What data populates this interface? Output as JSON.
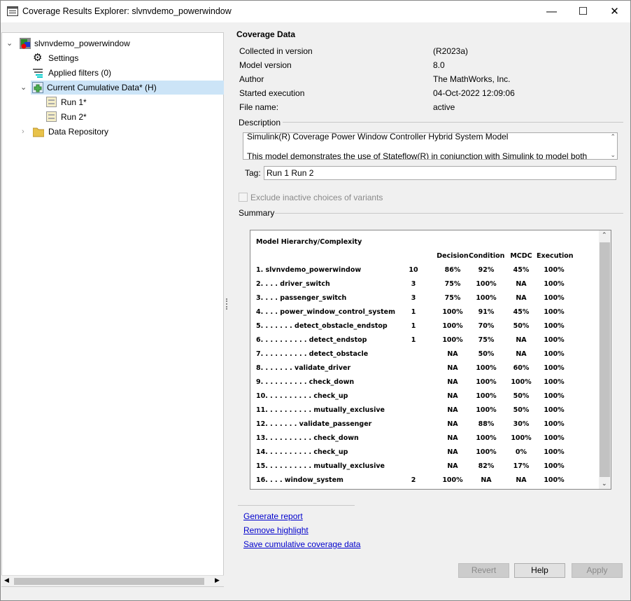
{
  "window": {
    "title": "Coverage Results Explorer: slvnvdemo_powerwindow",
    "minimize": "—",
    "maximize": "☐",
    "close": "✕"
  },
  "tree": {
    "root": "slvnvdemo_powerwindow",
    "settings": "Settings",
    "filters": "Applied filters (0)",
    "cumulative": "Current Cumulative Data* (H)",
    "runs": [
      "Run 1*",
      "Run 2*"
    ],
    "repository": "Data Repository"
  },
  "coverage": {
    "title": "Coverage Data",
    "fields": [
      {
        "label": "Collected in version",
        "value": "(R2023a)"
      },
      {
        "label": "Model version",
        "value": "8.0"
      },
      {
        "label": "Author",
        "value": "The MathWorks, Inc."
      },
      {
        "label": "Started execution",
        "value": "04-Oct-2022 12:09:06"
      },
      {
        "label": "File name:",
        "value": "active"
      }
    ],
    "description_label": "Description",
    "description_lines": [
      "Simulink(R) Coverage Power Window Controller Hybrid System Model",
      "",
      "This model demonstrates the use of Stateflow(R) in conjunction with Simulink to model both"
    ],
    "tag_label": "Tag:",
    "tag_value": "Run 1 Run 2",
    "exclude_label": "Exclude inactive choices of variants",
    "summary_label": "Summary"
  },
  "summary": {
    "heading": "Model Hierarchy/Complexity",
    "columns": [
      "Decision",
      "Condition",
      "MCDC",
      "Execution"
    ],
    "rows": [
      [
        "1. slvnvdemo_powerwindow",
        "10",
        "86%",
        "92%",
        "45%",
        "100%"
      ],
      [
        "2. . . . driver_switch",
        "3",
        "75%",
        "100%",
        "NA",
        "100%"
      ],
      [
        "3. . . . passenger_switch",
        "3",
        "75%",
        "100%",
        "NA",
        "100%"
      ],
      [
        "4. . . . power_window_control_system",
        "1",
        "100%",
        "91%",
        "45%",
        "100%"
      ],
      [
        "5. . . . . . . detect_obstacle_endstop",
        "1",
        "100%",
        "70%",
        "50%",
        "100%"
      ],
      [
        "6. . . . . . . . . . detect_endstop",
        "1",
        "100%",
        "75%",
        "NA",
        "100%"
      ],
      [
        "7. . . . . . . . . . detect_obstacle",
        "",
        "NA",
        "50%",
        "NA",
        "100%"
      ],
      [
        "8. . . . . . . validate_driver",
        "",
        "NA",
        "100%",
        "60%",
        "100%"
      ],
      [
        "9. . . . . . . . . . check_down",
        "",
        "NA",
        "100%",
        "100%",
        "100%"
      ],
      [
        "10. . . . . . . . . . check_up",
        "",
        "NA",
        "100%",
        "50%",
        "100%"
      ],
      [
        "11. . . . . . . . . . mutually_exclusive",
        "",
        "NA",
        "100%",
        "50%",
        "100%"
      ],
      [
        "12. . . . . . . validate_passenger",
        "",
        "NA",
        "88%",
        "30%",
        "100%"
      ],
      [
        "13. . . . . . . . . . check_down",
        "",
        "NA",
        "100%",
        "100%",
        "100%"
      ],
      [
        "14. . . . . . . . . . check_up",
        "",
        "NA",
        "100%",
        "0%",
        "100%"
      ],
      [
        "15. . . . . . . . . . mutually_exclusive",
        "",
        "NA",
        "82%",
        "17%",
        "100%"
      ],
      [
        "16. . . . window_system",
        "2",
        "100%",
        "NA",
        "NA",
        "100%"
      ]
    ]
  },
  "links": [
    "Generate report",
    "Remove highlight",
    "Save cumulative coverage data"
  ],
  "buttons": {
    "revert": "Revert",
    "help": "Help",
    "apply": "Apply"
  }
}
